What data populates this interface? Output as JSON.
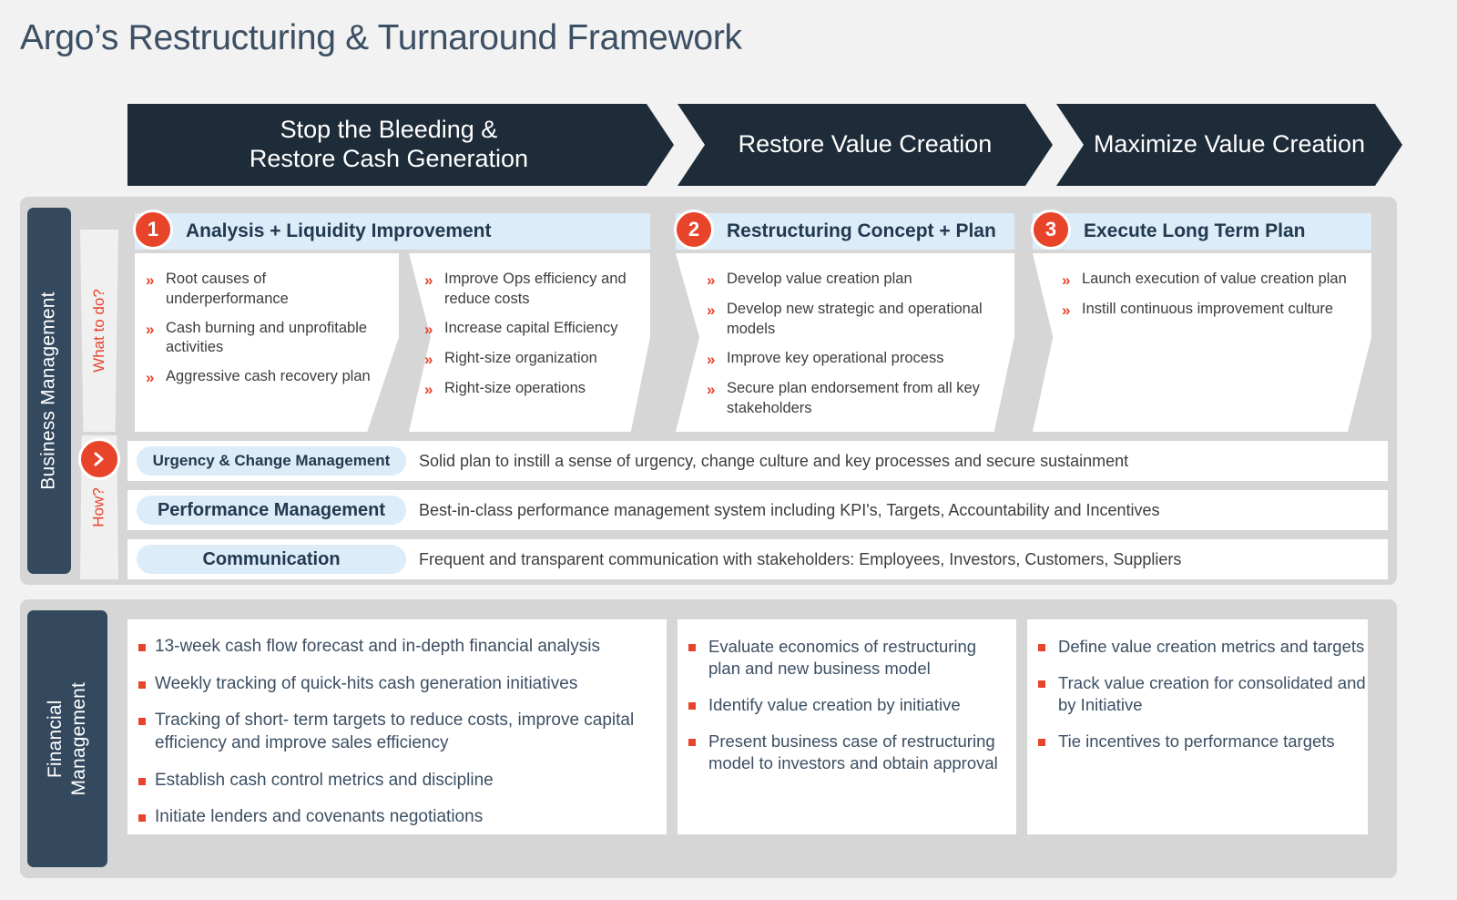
{
  "title": "Argo’s Restructuring & Turnaround Framework",
  "banner": {
    "phases": [
      {
        "line1": "Stop the Bleeding &",
        "line2": "Restore Cash Generation"
      },
      {
        "line1": "Restore Value Creation",
        "line2": ""
      },
      {
        "line1": "Maximize Value Creation",
        "line2": ""
      }
    ]
  },
  "business_management": {
    "label": "Business Management",
    "what_to_do_label": "What to do?",
    "how_label": "How?",
    "arrow_icon": "chevron-right-icon",
    "steps": [
      {
        "number": "1",
        "title": "Analysis +  Liquidity Improvement"
      },
      {
        "number": "2",
        "title": "Restructuring Concept + Plan"
      },
      {
        "number": "3",
        "title": "Execute Long Term Plan"
      }
    ],
    "bullet_marker": "»",
    "columns": [
      {
        "items": [
          "Root causes of underperformance",
          "Cash burning and unprofitable activities",
          "Aggressive cash recovery plan"
        ]
      },
      {
        "items": [
          "Improve Ops efficiency and reduce costs",
          "Increase capital Efficiency",
          "Right-size organization",
          "Right-size operations"
        ]
      },
      {
        "items": [
          "Develop value creation plan",
          "Develop new strategic and operational models",
          "Improve key operational process",
          "Secure plan endorsement from all key stakeholders"
        ]
      },
      {
        "items": [
          "Launch execution of value creation plan",
          "Instill continuous improvement culture"
        ]
      }
    ],
    "how_rows": [
      {
        "pill": "Urgency & Change Management",
        "description": "Solid plan to instill a sense of urgency, change culture and key processes and secure sustainment"
      },
      {
        "pill": "Performance Management",
        "description": "Best-in-class performance management system including KPI's, Targets, Accountability and Incentives"
      },
      {
        "pill": "Communication",
        "description": "Frequent and transparent communication with stakeholders: Employees, Investors, Customers, Suppliers"
      }
    ]
  },
  "financial_management": {
    "label_line1": "Financial",
    "label_line2": "Management",
    "columns": [
      {
        "items": [
          "13-week cash flow forecast and in-depth financial analysis",
          "Weekly tracking of quick-hits cash generation initiatives",
          "Tracking of short- term targets to reduce costs, improve capital efficiency and improve sales efficiency",
          "Establish cash control metrics and discipline",
          "Initiate lenders and covenants negotiations"
        ]
      },
      {
        "items": [
          "Evaluate economics of restructuring plan and new business model",
          "Identify value creation by initiative",
          "Present business case of restructuring model to investors and obtain approval"
        ]
      },
      {
        "items": [
          "Define value creation metrics and targets",
          "Track value creation for consolidated and by Initiative",
          "Tie incentives to performance targets"
        ]
      }
    ]
  },
  "colors": {
    "background": "#f2f2f2",
    "dark_navy": "#1e2b38",
    "slate": "#34495e",
    "accent_red": "#e8442a",
    "light_blue": "#dcecf8",
    "card_grey": "#d6d6d6",
    "text_navy": "#3c4f63"
  }
}
